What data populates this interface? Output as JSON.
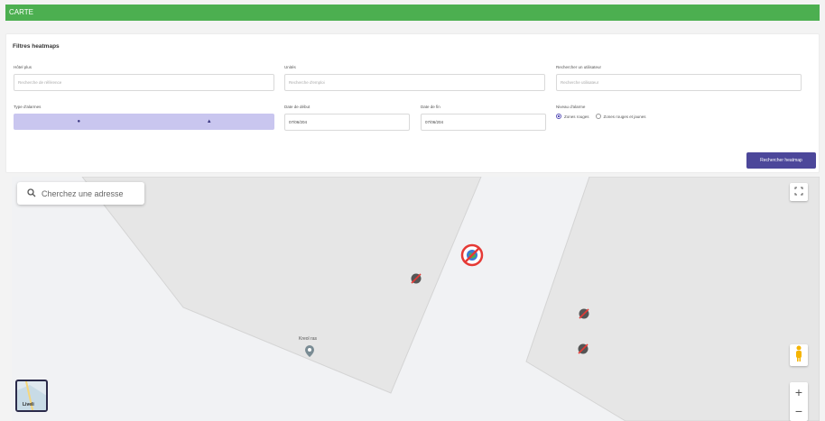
{
  "header": {
    "title": "CARTE"
  },
  "filters": {
    "title": "Filtres heatmaps",
    "fields": [
      {
        "label": "Hôtel plus",
        "placeholder": "Recherche de référence"
      },
      {
        "label": "Unités",
        "placeholder": "Recherche d'emploi"
      },
      {
        "label": "Rechercher un utilisateur",
        "placeholder": "Recherche utilisateur"
      }
    ],
    "alarm_type_label": "Type d'alarmes",
    "alarm_type_options": [
      "person",
      "car"
    ],
    "date_start_label": "Date de début",
    "date_start_value": "07/06/204",
    "date_end_label": "Date de fin",
    "date_end_value": "07/06/204",
    "level_label": "Niveau d'alarme",
    "level_options": [
      {
        "label": "Zones rouges",
        "selected": true
      },
      {
        "label": "Zones rouges et jaunes",
        "selected": false
      }
    ],
    "search_button": "Rechercher heatmap"
  },
  "map": {
    "address_placeholder": "Cherchez une adresse",
    "place_label": "Kreol ras",
    "layer_label": "Liveli",
    "zoom_in": "+",
    "zoom_out": "−",
    "markers": [
      "blocked-camera",
      "blocked-camera",
      "blocked-camera",
      "blocked-camera"
    ],
    "highlight_marker": "prohibited-globe"
  },
  "colors": {
    "header": "#4caf50",
    "accent": "#4c479a",
    "toggle": "#c9c6ef"
  }
}
